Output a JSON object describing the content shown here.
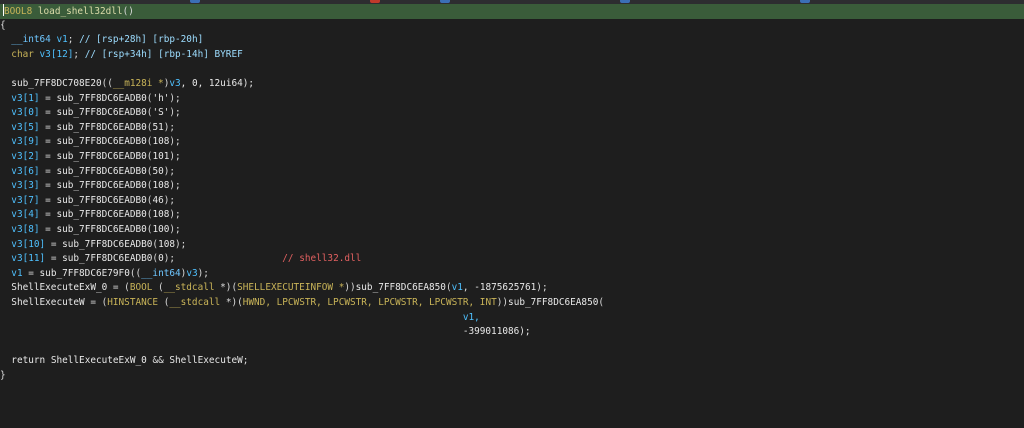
{
  "tab_marks": [
    {
      "color": "#3b6fb6"
    },
    {
      "color": "#c0392b"
    },
    {
      "color": "#3b6fb6"
    },
    {
      "color": "#3b6fb6"
    },
    {
      "color": "#3b6fb6"
    }
  ],
  "code": {
    "signature": {
      "ret_type": "BOOL8",
      "name": "load_shell32dll",
      "params": "()"
    },
    "open_brace": "{",
    "decl1": {
      "type": "__int64",
      "name": "v1",
      "comment": "// [rsp+28h] [rbp-20h]"
    },
    "decl2": {
      "type": "char",
      "name": "v3[12]",
      "comment": "// [rsp+34h] [rbp-14h] BYREF"
    },
    "memset": {
      "fn": "sub_7FF8DC708E20",
      "cast": "__m128i *",
      "var": "v3",
      "args": ", 0, 12ui64);"
    },
    "assigns": [
      {
        "lhs": "v3[1]",
        "fn": "sub_7FF8DC6EADB0",
        "arg": "'h'"
      },
      {
        "lhs": "v3[0]",
        "fn": "sub_7FF8DC6EADB0",
        "arg": "'S'"
      },
      {
        "lhs": "v3[5]",
        "fn": "sub_7FF8DC6EADB0",
        "arg": "51"
      },
      {
        "lhs": "v3[9]",
        "fn": "sub_7FF8DC6EADB0",
        "arg": "108"
      },
      {
        "lhs": "v3[2]",
        "fn": "sub_7FF8DC6EADB0",
        "arg": "101"
      },
      {
        "lhs": "v3[6]",
        "fn": "sub_7FF8DC6EADB0",
        "arg": "50"
      },
      {
        "lhs": "v3[3]",
        "fn": "sub_7FF8DC6EADB0",
        "arg": "108"
      },
      {
        "lhs": "v3[7]",
        "fn": "sub_7FF8DC6EADB0",
        "arg": "46"
      },
      {
        "lhs": "v3[4]",
        "fn": "sub_7FF8DC6EADB0",
        "arg": "108"
      },
      {
        "lhs": "v3[8]",
        "fn": "sub_7FF8DC6EADB0",
        "arg": "100"
      },
      {
        "lhs": "v3[10]",
        "fn": "sub_7FF8DC6EADB0",
        "arg": "108"
      },
      {
        "lhs": "v3[11]",
        "fn": "sub_7FF8DC6EADB0",
        "arg": "0",
        "comment": "// shell32.dll"
      }
    ],
    "v1_assign": {
      "lhs": "v1",
      "fn": "sub_7FF8DC6E79F0",
      "cast": "__int64",
      "var": "v3"
    },
    "shellexec_ex": {
      "lhs": "ShellExecuteExW_0",
      "cast_ret": "BOOL",
      "callconv": "__stdcall",
      "param_type": "SHELLEXECUTEINFOW *",
      "fn": "sub_7FF8DC6EA850",
      "arg_var": "v1",
      "arg_num": "-1875625761"
    },
    "shellexec": {
      "lhs": "ShellExecuteW",
      "cast_ret": "HINSTANCE",
      "callconv": "__stdcall",
      "param_types": "HWND, LPCWSTR, LPCWSTR, LPCWSTR, LPCWSTR, INT",
      "fn": "sub_7FF8DC6EA850",
      "arg_var": "v1,",
      "arg_num": "-399011086);"
    },
    "return_stmt": {
      "kw": "return",
      "a": "ShellExecuteExW_0",
      "op": "&&",
      "b": "ShellExecuteW"
    },
    "close_brace": "}"
  }
}
